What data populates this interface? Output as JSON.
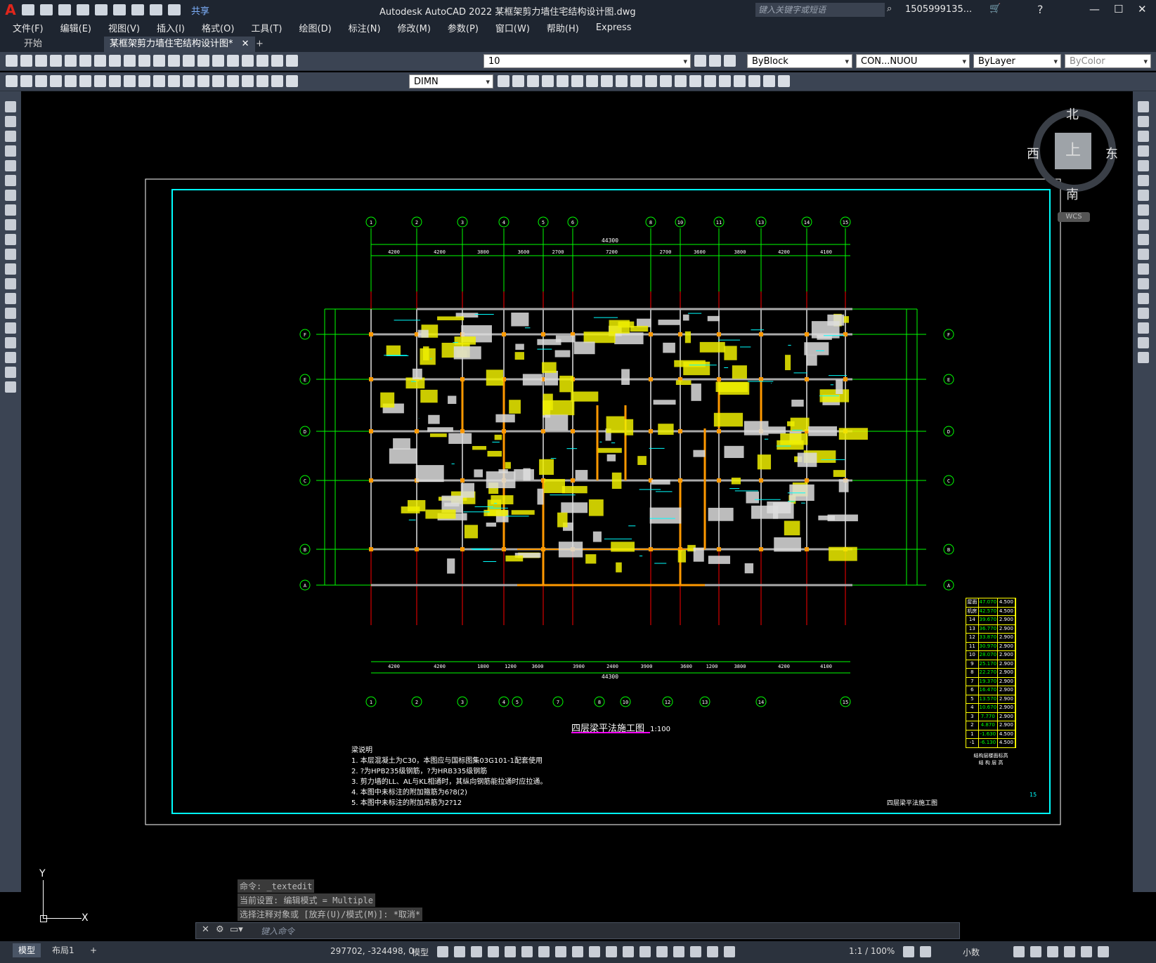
{
  "app": {
    "logo": "A",
    "title": "Autodesk AutoCAD 2022    某框架剪力墙住宅结构设计图.dwg",
    "search_placeholder": "键入关键字或短语",
    "user": "1505999135...",
    "share": "共享"
  },
  "menu": [
    "文件(F)",
    "编辑(E)",
    "视图(V)",
    "插入(I)",
    "格式(O)",
    "工具(T)",
    "绘图(D)",
    "标注(N)",
    "修改(M)",
    "参数(P)",
    "窗口(W)",
    "帮助(H)",
    "Express"
  ],
  "tabs": [
    {
      "label": "开始"
    },
    {
      "label": "某框架剪力墙住宅结构设计图*"
    }
  ],
  "toolbar": {
    "layer_value": "10",
    "color_value": "ByBlock",
    "linetype_value": "CON...NUOU",
    "lineweight_value": "ByLayer",
    "plotstyle_value": "ByColor",
    "dimstyle_value": "DIMN"
  },
  "viewcube": {
    "north": "北",
    "south": "南",
    "east": "东",
    "west": "西",
    "top": "上",
    "wcs": "WCS"
  },
  "ucs": {
    "y": "Y",
    "x": "X"
  },
  "drawing": {
    "title": "四层梁平法施工图",
    "scale": "1:100",
    "notes_header": "梁说明",
    "notes": [
      "1. 本层混凝土为C30，本图应与国标图集03G101-1配套使用",
      "2. ?为HPB235级钢筋，?为HRB335级钢筋",
      "3. 剪力墙的LL、AL与KL相通时，其纵向钢筋能拉通时应拉通。",
      "4. 本图中未标注的附加箍筋为6?8(2)",
      "5. 本图中未标注的附加吊筋为2?12"
    ],
    "titleblock_name": "四层梁平法施工图",
    "sheet_no": "15",
    "top_axes": [
      "1",
      "2",
      "3",
      "4",
      "5",
      "6",
      "8",
      "10",
      "11",
      "13",
      "14",
      "15"
    ],
    "bottom_axes": [
      "1",
      "2",
      "3",
      "4",
      "5",
      "7",
      "8",
      "10",
      "12",
      "13",
      "14",
      "15"
    ],
    "left_axes": [
      "F",
      "E",
      "D",
      "C",
      "B",
      "A"
    ],
    "total_dim": "44300",
    "top_dims": [
      "4200",
      "4200",
      "3800",
      "3600",
      "2700",
      "7200",
      "2700",
      "3600",
      "3800",
      "4200",
      "4100"
    ],
    "bottom_dims": [
      "4200",
      "4200",
      "1800",
      "1200",
      "3600",
      "3900",
      "2400",
      "3900",
      "3600",
      "1200",
      "3800",
      "4200",
      "4100"
    ],
    "level_table": [
      [
        "屋面",
        "47.070",
        "4.500"
      ],
      [
        "机房",
        "42.570",
        "4.500"
      ],
      [
        "14",
        "39.670",
        "2.900"
      ],
      [
        "13",
        "36.770",
        "2.900"
      ],
      [
        "12",
        "33.870",
        "2.900"
      ],
      [
        "11",
        "30.970",
        "2.900"
      ],
      [
        "10",
        "28.070",
        "2.900"
      ],
      [
        "9",
        "25.170",
        "2.900"
      ],
      [
        "8",
        "22.270",
        "2.900"
      ],
      [
        "7",
        "19.370",
        "2.900"
      ],
      [
        "6",
        "16.470",
        "2.900"
      ],
      [
        "5",
        "13.570",
        "2.900"
      ],
      [
        "4",
        "10.670",
        "2.900"
      ],
      [
        "3",
        "7.770",
        "2.900"
      ],
      [
        "2",
        "4.870",
        "2.900"
      ],
      [
        "1",
        "-1.630",
        "4.500"
      ],
      [
        "-1",
        "-6.130",
        "4.500"
      ]
    ],
    "level_table_footer": "结构层楼面标高",
    "level_table_footer2": "结 构 层 高"
  },
  "command": {
    "line1": "命令: _textedit",
    "line2": "当前设置: 编辑模式 = Multiple",
    "line3": "选择注释对象或 [放弃(U)/模式(M)]: *取消*",
    "placeholder": "键入命令"
  },
  "status": {
    "tab_model": "模型",
    "tab_layout": "布局1",
    "coords": "297702, -324498, 0",
    "mode": "模型",
    "scale": "1:1 / 100%",
    "units": "小数"
  },
  "colors": {
    "accent": "#00ffff",
    "axis": "#00ff00",
    "beam_red": "#ff0000",
    "annot": "#ffff00",
    "bg": "#000000",
    "chrome": "#3b4453"
  }
}
